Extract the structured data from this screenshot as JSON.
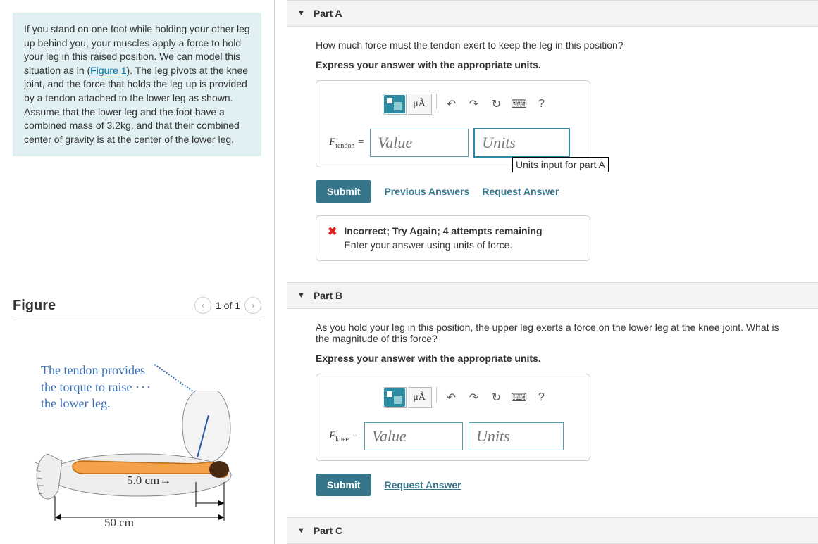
{
  "problem": {
    "intro_parts": [
      "If you stand on one foot while holding your other leg up behind you, your muscles apply a force to hold your leg in this raised position. We can model this situation as in (",
      "Figure 1",
      "). The leg pivots at the knee joint, and the force that holds the leg up is provided by a tendon attached to the lower leg as shown. Assume that the lower leg and the foot have a combined mass of 3.2kg, and that their combined center of gravity is at the center of the lower leg."
    ]
  },
  "figure": {
    "title": "Figure",
    "pager": "1 of 1",
    "caption_l1": "The tendon provides",
    "caption_l2": "the torque to raise",
    "caption_l3": "the lower leg.",
    "dim_5cm": "5.0 cm",
    "dim_50cm": "50 cm"
  },
  "parts": {
    "a": {
      "header": "Part A",
      "question": "How much force must the tendon exert to keep the leg in this position?",
      "instruction": "Express your answer with the appropriate units.",
      "var_label_main": "F",
      "var_label_sub": "tendon",
      "value_placeholder": "Value",
      "units_placeholder": "Units",
      "tooltip": "Units input for part A",
      "submit": "Submit",
      "prev_answers": "Previous Answers",
      "request_answer": "Request Answer",
      "feedback_title": "Incorrect; Try Again; 4 attempts remaining",
      "feedback_msg": "Enter your answer using units of force."
    },
    "b": {
      "header": "Part B",
      "question": "As you hold your leg in this position, the upper leg exerts a force on the lower leg at the knee joint. What is the magnitude of this force?",
      "instruction": "Express your answer with the appropriate units.",
      "var_label_main": "F",
      "var_label_sub": "knee",
      "value_placeholder": "Value",
      "units_placeholder": "Units",
      "submit": "Submit",
      "request_answer": "Request Answer"
    },
    "c": {
      "header": "Part C"
    }
  },
  "toolbar": {
    "mu_a": "μÅ",
    "help": "?"
  }
}
